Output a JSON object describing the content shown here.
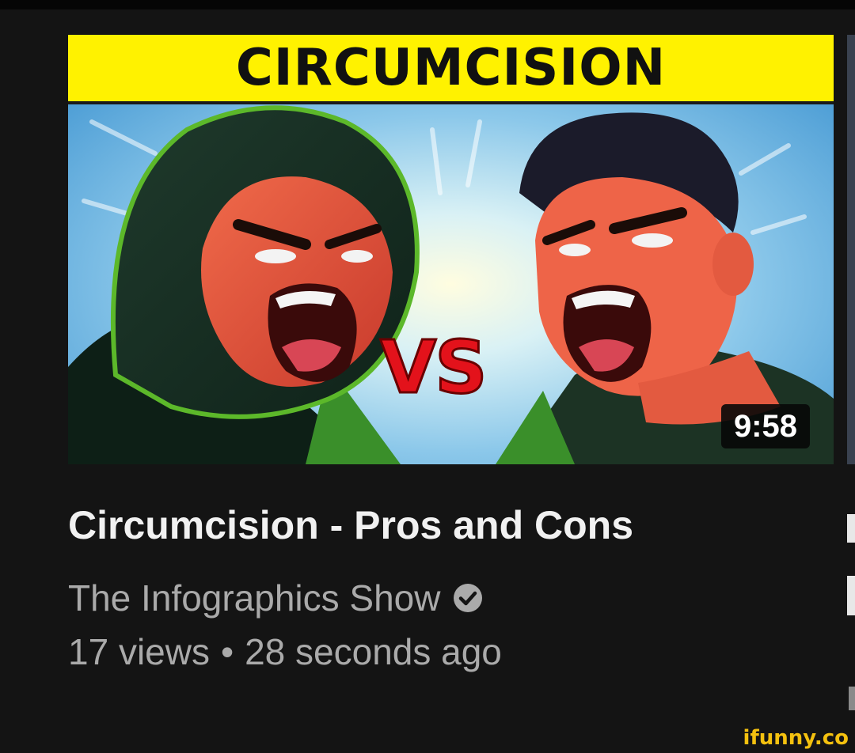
{
  "video": {
    "thumbnail_banner": "CIRCUMCISION",
    "thumbnail_versus": "VS",
    "duration": "9:58",
    "title": "Circumcision - Pros and Cons",
    "channel": "The Infographics Show",
    "channel_verified": true,
    "views": "17 views",
    "separator": "•",
    "uploaded": "28 seconds ago"
  },
  "colors": {
    "background": "#141414",
    "banner_yellow": "#fff200",
    "vs_red": "#e3121b",
    "title": "#f1f1f1",
    "secondary_text": "#aaaaaa"
  },
  "icons": {
    "verified": "verified-check-icon"
  },
  "watermark": "ifunny.co"
}
